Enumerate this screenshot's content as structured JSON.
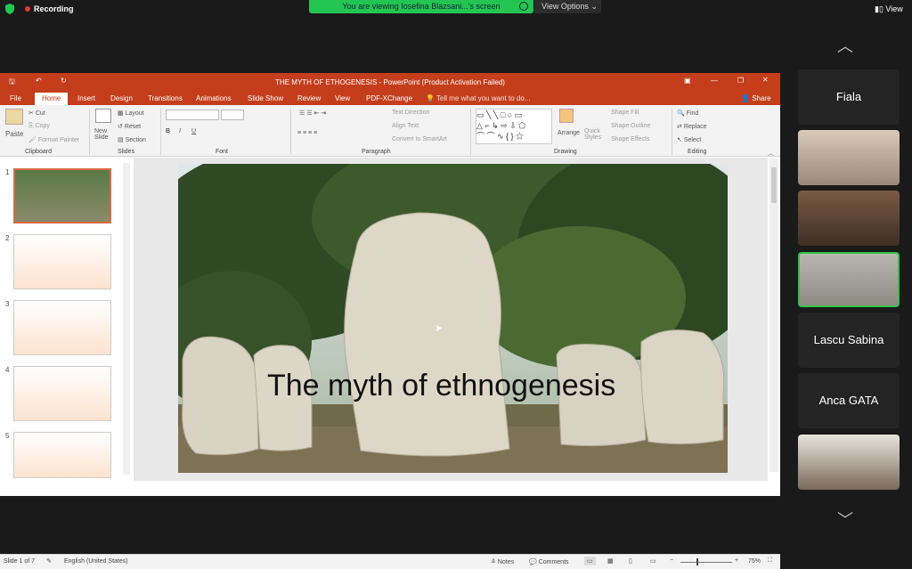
{
  "zoom": {
    "recording": "Recording",
    "viewing_banner": "You are viewing Iosefina Blazsani...'s screen",
    "view_options": "View Options",
    "view_button": "View"
  },
  "ppt": {
    "title": "THE MYTH OF ETHOGENESIS - PowerPoint (Product Activation Failed)",
    "tabs": [
      "File",
      "Home",
      "Insert",
      "Design",
      "Transitions",
      "Animations",
      "Slide Show",
      "Review",
      "View",
      "PDF-XChange"
    ],
    "tell_me": "Tell me what you want to do...",
    "share": "Share",
    "ribbon": {
      "paste": "Paste",
      "cut": "Cut",
      "copy": "Copy",
      "format_painter": "Format Painter",
      "clipboard": "Clipboard",
      "new_slide": "New Slide",
      "layout": "Layout",
      "reset": "Reset",
      "section": "Section",
      "slides": "Slides",
      "font": "Font",
      "text_direction": "Text Direction",
      "align_text": "Align Text",
      "convert_smartart": "Convert to SmartArt",
      "paragraph": "Paragraph",
      "arrange": "Arrange",
      "quick_styles": "Quick Styles",
      "shape_fill": "Shape Fill",
      "shape_outline": "Shape Outline",
      "shape_effects": "Shape Effects",
      "drawing": "Drawing",
      "find": "Find",
      "replace": "Replace",
      "select": "Select",
      "editing": "Editing"
    },
    "slide_numbers": [
      "1",
      "2",
      "3",
      "4",
      "5"
    ],
    "slide_title": "The myth of ethnogenesis",
    "status": {
      "slide_count": "Slide 1 of 7",
      "language": "English (United States)",
      "notes": "Notes",
      "comments": "Comments",
      "zoom": "75%"
    }
  },
  "participants": [
    {
      "name": "Fiala",
      "video": false
    },
    {
      "name": "",
      "video": true
    },
    {
      "name": "",
      "video": true
    },
    {
      "name": "",
      "video": true,
      "active": true
    },
    {
      "name": "Lascu Sabina",
      "video": false
    },
    {
      "name": "Anca GATA",
      "video": false
    },
    {
      "name": "",
      "video": true
    }
  ]
}
